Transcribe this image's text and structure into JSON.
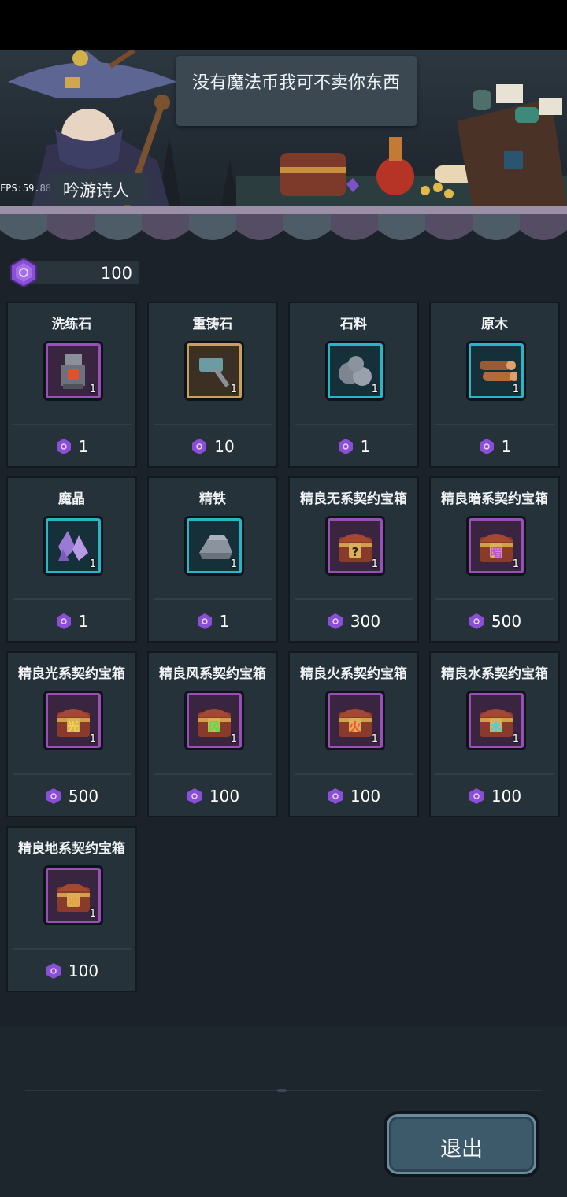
{
  "hud": {
    "fps": "FPS:59.88"
  },
  "npc": {
    "name": "吟游诗人",
    "dialogue": "没有魔法币我可不卖你东西"
  },
  "wallet": {
    "icon": "magic-coin-icon",
    "amount": "100"
  },
  "items": [
    {
      "name": "洗练石",
      "qty": "1",
      "price": "1",
      "frame": "purple",
      "icon": "refining-stone-icon"
    },
    {
      "name": "重铸石",
      "qty": "1",
      "price": "10",
      "frame": "gold",
      "icon": "reforge-hammer-icon"
    },
    {
      "name": "石料",
      "qty": "1",
      "price": "1",
      "frame": "cyan",
      "icon": "stone-icon"
    },
    {
      "name": "原木",
      "qty": "1",
      "price": "1",
      "frame": "cyan",
      "icon": "log-icon"
    },
    {
      "name": "魔晶",
      "qty": "1",
      "price": "1",
      "frame": "cyan",
      "icon": "magic-crystal-icon"
    },
    {
      "name": "精铁",
      "qty": "1",
      "price": "1",
      "frame": "cyan",
      "icon": "iron-ingot-icon"
    },
    {
      "name": "精良无系契约宝箱",
      "qty": "1",
      "price": "300",
      "frame": "purple",
      "icon": "chest-icon",
      "glyph": "?"
    },
    {
      "name": "精良暗系契约宝箱",
      "qty": "1",
      "price": "500",
      "frame": "purple",
      "icon": "chest-icon",
      "glyph": "暗"
    },
    {
      "name": "精良光系契约宝箱",
      "qty": "1",
      "price": "500",
      "frame": "purple",
      "icon": "chest-icon",
      "glyph": "光"
    },
    {
      "name": "精良风系契约宝箱",
      "qty": "1",
      "price": "100",
      "frame": "purple",
      "icon": "chest-icon",
      "glyph": "风"
    },
    {
      "name": "精良火系契约宝箱",
      "qty": "1",
      "price": "100",
      "frame": "purple",
      "icon": "chest-icon",
      "glyph": "火"
    },
    {
      "name": "精良水系契约宝箱",
      "qty": "1",
      "price": "100",
      "frame": "purple",
      "icon": "chest-icon",
      "glyph": "水"
    },
    {
      "name": "精良地系契约宝箱",
      "qty": "1",
      "price": "100",
      "frame": "purple",
      "icon": "chest-icon",
      "glyph": "地"
    }
  ],
  "buttons": {
    "exit": "退出"
  },
  "colors": {
    "gem": "#8a4fd6",
    "glyph_dark": "#c04fe0",
    "glyph_light": "#f4d24a",
    "glyph_wind": "#4ee04a",
    "glyph_fire": "#ff4a3a",
    "glyph_water": "#3ad2f0",
    "glyph_earth": "#e8a040"
  }
}
